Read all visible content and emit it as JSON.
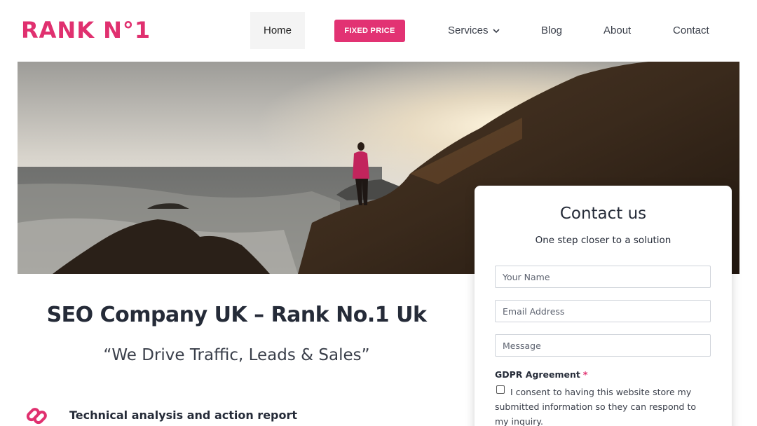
{
  "brand": {
    "logo_text": "RANK N°1",
    "accent": "#e0306f"
  },
  "nav": {
    "home": "Home",
    "fixed_price": "FIXED PRICE",
    "services": "Services",
    "blog": "Blog",
    "about": "About",
    "contact": "Contact"
  },
  "hero": {
    "image": "man standing on rocky coastline at sunset"
  },
  "main": {
    "title": "SEO Company UK – Rank No.1 Uk",
    "tagline": "“We Drive Traffic, Leads & Sales”",
    "feature": {
      "icon": "link-icon",
      "label": "Technical analysis and action report"
    }
  },
  "contact_form": {
    "title": "Contact us",
    "subtitle": "One step closer to a solution",
    "name_placeholder": "Your Name",
    "email_placeholder": "Email Address",
    "message_placeholder": "Message",
    "gdpr_label": "GDPR Agreement",
    "gdpr_required": "*",
    "gdpr_text": "I consent to having this website store my submitted information so they can respond to my inquiry."
  }
}
